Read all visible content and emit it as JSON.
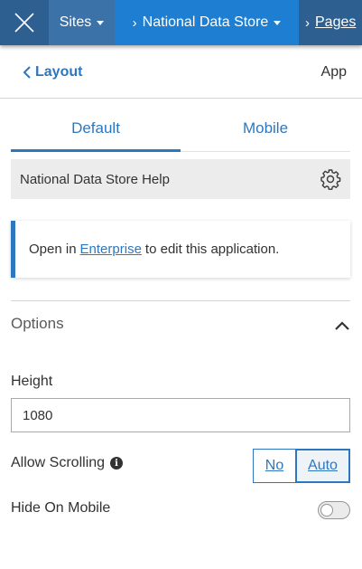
{
  "nav": {
    "sites_label": "Sites",
    "site_name": "National Data Store",
    "pages_label": "Pages"
  },
  "panel": {
    "back_label": "Layout",
    "app_label": "App"
  },
  "tabs": [
    {
      "label": "Default",
      "active": true
    },
    {
      "label": "Mobile",
      "active": false
    }
  ],
  "page": {
    "name": "National Data Store Help"
  },
  "notice": {
    "prefix": "Open in",
    "link": "Enterprise",
    "suffix": "to edit this application."
  },
  "options": {
    "title": "Options",
    "height_label": "Height",
    "height_value": "1080",
    "scrolling_label": "Allow Scrolling",
    "scrolling_options": [
      "No",
      "Auto"
    ],
    "scrolling_selected": "Auto",
    "hide_mobile_label": "Hide On Mobile",
    "hide_mobile_on": false
  },
  "colors": {
    "accent": "#2e77be",
    "topbar": "#3b72a8",
    "topbar_active": "#1e7ed1"
  },
  "icons": {
    "close": "close-icon",
    "back": "chevron-left-icon",
    "settings": "gear-icon",
    "collapse": "chevron-up-icon",
    "info": "info-icon"
  }
}
